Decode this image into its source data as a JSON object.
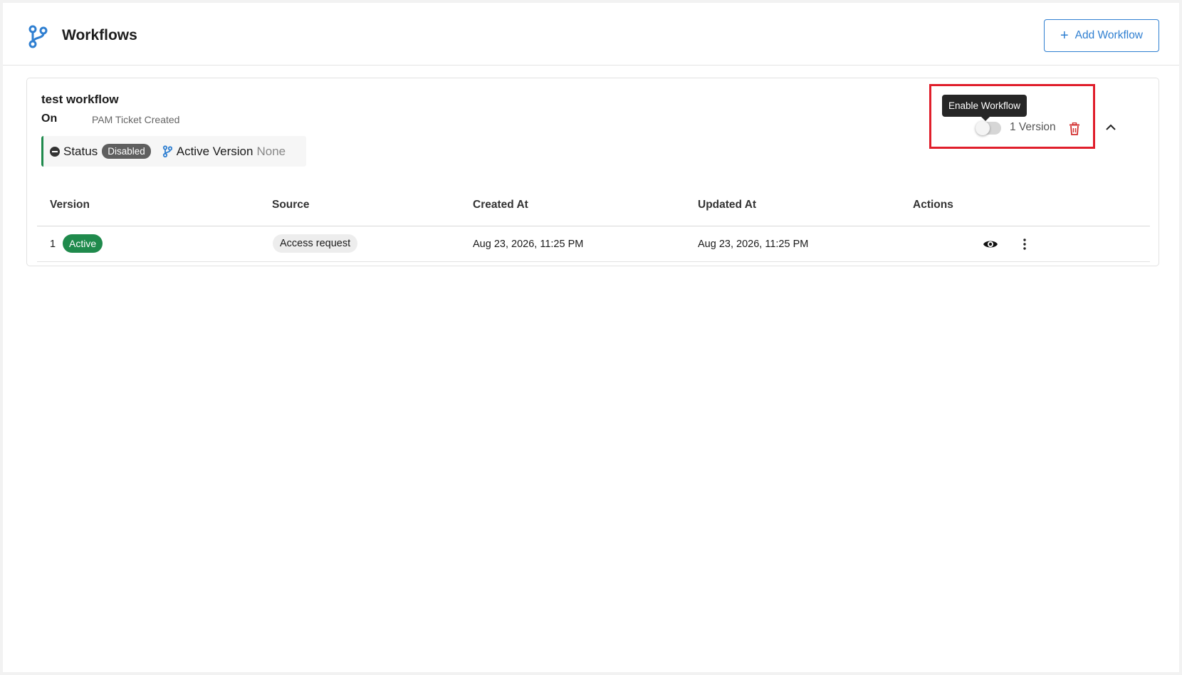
{
  "header": {
    "title": "Workflows",
    "add_button_label": "Add Workflow"
  },
  "workflow": {
    "name": "test workflow",
    "on_label": "On",
    "trigger": "PAM Ticket Created",
    "status_label": "Status",
    "status_value": "Disabled",
    "active_version_label": "Active Version",
    "active_version_value": "None",
    "tooltip": "Enable Workflow",
    "enabled": false,
    "version_count": "1 Version"
  },
  "table": {
    "columns": [
      "Version",
      "Source",
      "Created At",
      "Updated At",
      "Actions"
    ],
    "rows": [
      {
        "version": "1",
        "state": "Active",
        "source": "Access request",
        "created_at": "Aug 23, 2026, 11:25 PM",
        "updated_at": "Aug 23, 2026, 11:25 PM"
      }
    ]
  },
  "colors": {
    "accent": "#2f7fd1",
    "active": "#1f8a4c",
    "highlight": "#e01e2b",
    "delete": "#d32f2f"
  },
  "icons": {
    "logo": "git-branch-icon",
    "status": "minus-circle-icon",
    "active_version": "git-branch-icon",
    "delete": "trash-icon",
    "collapse": "chevron-up-icon",
    "view": "eye-icon",
    "more": "more-vertical-icon"
  }
}
